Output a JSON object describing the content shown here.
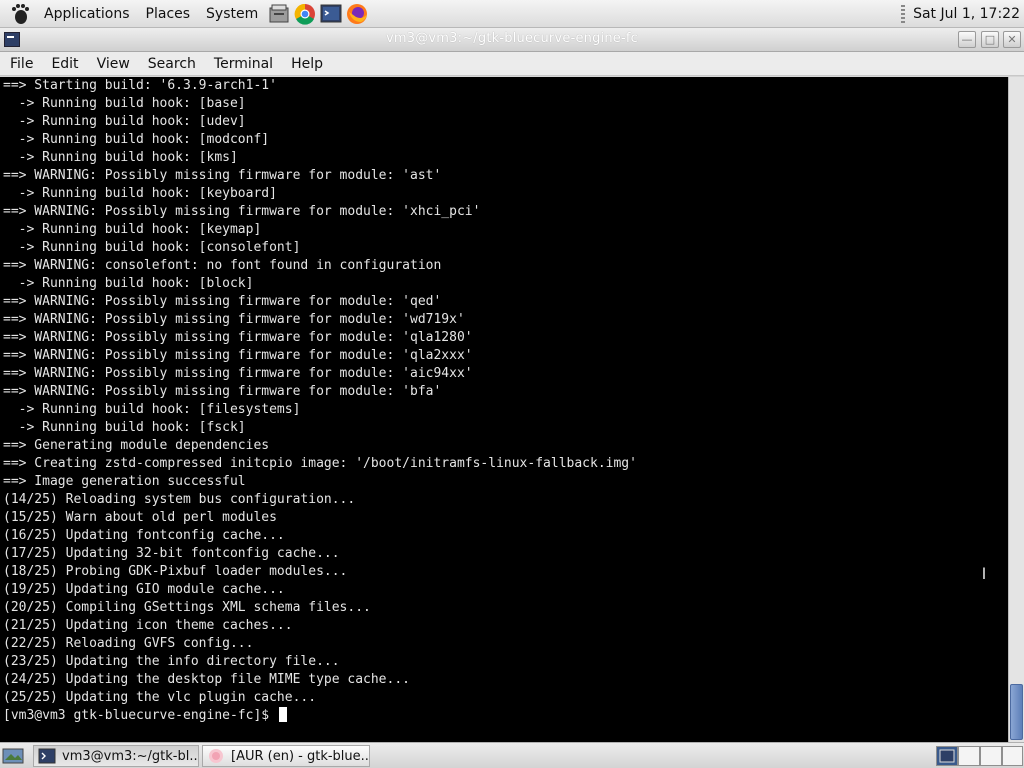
{
  "top_panel": {
    "menus": [
      "Applications",
      "Places",
      "System"
    ],
    "launchers": [
      "file-manager-icon",
      "chromium-icon",
      "terminal-icon",
      "firefox-icon"
    ],
    "clock": "Sat Jul  1, 17:22"
  },
  "window": {
    "title": "vm3@vm3:~/gtk-bluecurve-engine-fc",
    "menu": [
      "File",
      "Edit",
      "View",
      "Search",
      "Terminal",
      "Help"
    ]
  },
  "terminal": {
    "lines": [
      "==> Starting build: '6.3.9-arch1-1'",
      "  -> Running build hook: [base]",
      "  -> Running build hook: [udev]",
      "  -> Running build hook: [modconf]",
      "  -> Running build hook: [kms]",
      "==> WARNING: Possibly missing firmware for module: 'ast'",
      "  -> Running build hook: [keyboard]",
      "==> WARNING: Possibly missing firmware for module: 'xhci_pci'",
      "  -> Running build hook: [keymap]",
      "  -> Running build hook: [consolefont]",
      "==> WARNING: consolefont: no font found in configuration",
      "  -> Running build hook: [block]",
      "==> WARNING: Possibly missing firmware for module: 'qed'",
      "==> WARNING: Possibly missing firmware for module: 'wd719x'",
      "==> WARNING: Possibly missing firmware for module: 'qla1280'",
      "==> WARNING: Possibly missing firmware for module: 'qla2xxx'",
      "==> WARNING: Possibly missing firmware for module: 'aic94xx'",
      "==> WARNING: Possibly missing firmware for module: 'bfa'",
      "  -> Running build hook: [filesystems]",
      "  -> Running build hook: [fsck]",
      "==> Generating module dependencies",
      "==> Creating zstd-compressed initcpio image: '/boot/initramfs-linux-fallback.img'",
      "==> Image generation successful",
      "(14/25) Reloading system bus configuration...",
      "(15/25) Warn about old perl modules",
      "(16/25) Updating fontconfig cache...",
      "(17/25) Updating 32-bit fontconfig cache...",
      "(18/25) Probing GDK-Pixbuf loader modules...",
      "(19/25) Updating GIO module cache...",
      "(20/25) Compiling GSettings XML schema files...",
      "(21/25) Updating icon theme caches...",
      "(22/25) Reloading GVFS config...",
      "(23/25) Updating the info directory file...",
      "(24/25) Updating the desktop file MIME type cache...",
      "(25/25) Updating the vlc plugin cache..."
    ],
    "prompt": "[vm3@vm3 gtk-bluecurve-engine-fc]$ "
  },
  "taskbar": {
    "tasks": [
      {
        "label": "vm3@vm3:~/gtk-bl...",
        "icon": "terminal-icon"
      },
      {
        "label": "[AUR (en) - gtk-blue...",
        "icon": "firefox-icon"
      }
    ]
  }
}
